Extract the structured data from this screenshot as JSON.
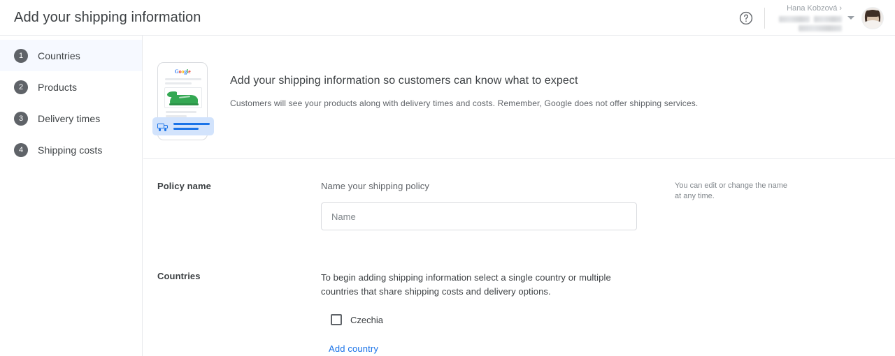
{
  "header": {
    "title": "Add your shipping information",
    "help_icon": "help-circle-icon",
    "account": {
      "user_name": "Hana Kobzová",
      "chevron": "›",
      "redacted": true
    }
  },
  "sidebar": {
    "items": [
      {
        "num": "1",
        "label": "Countries",
        "active": true
      },
      {
        "num": "2",
        "label": "Products",
        "active": false
      },
      {
        "num": "3",
        "label": "Delivery times",
        "active": false
      },
      {
        "num": "4",
        "label": "Shipping costs",
        "active": false
      }
    ]
  },
  "intro": {
    "heading": "Add your shipping information so customers can know what to expect",
    "subtext": "Customers will see your products along with delivery times and costs. Remember, Google does not offer shipping services.",
    "illustration": {
      "brand": "Google",
      "brand_letters": [
        "G",
        "o",
        "o",
        "g",
        "l",
        "e"
      ],
      "product": "green-sneaker"
    }
  },
  "form": {
    "policy": {
      "label": "Policy name",
      "caption": "Name your shipping policy",
      "input_placeholder": "Name",
      "input_value": "",
      "aside": "You can edit or change the name at any time."
    },
    "countries": {
      "label": "Countries",
      "description": "To begin adding shipping information select a single country or multiple countries that share shipping costs and delivery options.",
      "options": [
        {
          "name": "Czechia",
          "checked": false
        }
      ],
      "add_link": "Add country"
    }
  },
  "colors": {
    "accent_blue": "#1a73e8",
    "text_primary": "#3c4043",
    "text_secondary": "#5f6368",
    "badge_gray": "#5f6368",
    "selected_bg": "#e8f0fe",
    "border": "#dadce0"
  }
}
